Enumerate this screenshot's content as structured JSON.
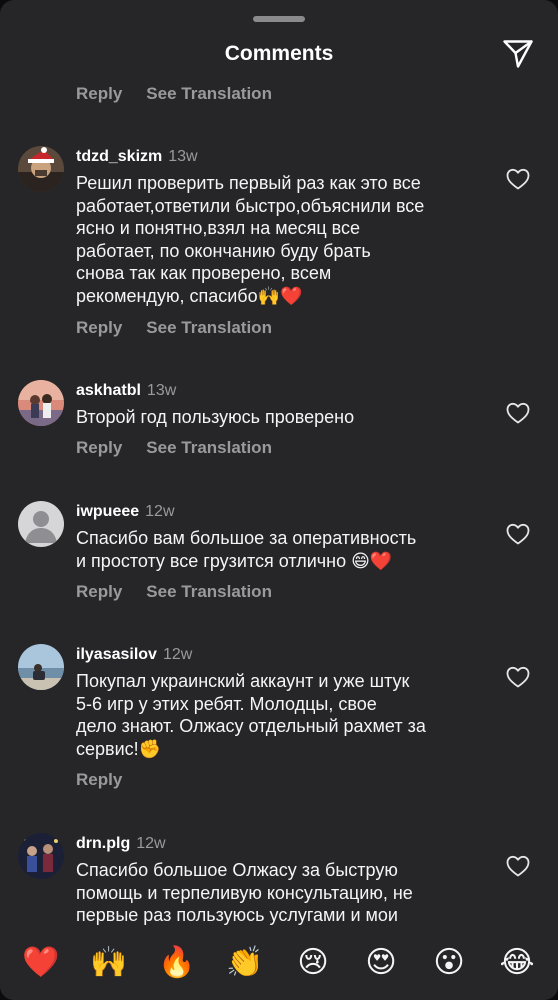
{
  "header": {
    "title": "Comments"
  },
  "actions": {
    "reply": "Reply",
    "see_translation": "See Translation"
  },
  "comments": [
    {
      "username": "tdzd_skizm",
      "time": "13w",
      "text_lines": [
        "Решил проверить первый раз как это все",
        "работает,ответили быстро,объяснили все",
        "ясно и понятно,взял на месяц все",
        "работает, по окончанию буду брать",
        "снова так как проверено, всем"
      ],
      "last_line": "рекомендую, спасибо",
      "emojis": "🙌❤️"
    },
    {
      "username": "askhatbl",
      "time": "13w",
      "text_lines": [
        "Второй год пользуюсь проверено"
      ]
    },
    {
      "username": "iwpueee",
      "time": "12w",
      "text_lines": [
        "Спасибо вам большое за оперативность"
      ],
      "last_line": "и простоту все грузится отлично ",
      "emojis": "😄❤️"
    },
    {
      "username": "ilyasasilov",
      "time": "12w",
      "text_lines": [
        "Покупал украинский аккаунт и уже штук",
        "5-6 игр у этих ребят. Молодцы, свое",
        "дело знают. Олжасу отдельный рахмет за"
      ],
      "last_line": "сервис!",
      "emojis": "✊"
    },
    {
      "username": "drn.plg",
      "time": "12w",
      "text_lines": [
        "Спасибо большое Олжасу за быструю",
        "помощь и терпеливую консультацию, не",
        "первые раз пользуюсь услугами и мои"
      ]
    }
  ],
  "reaction_bar": [
    "❤️",
    "🙌",
    "🔥",
    "👏",
    "😢",
    "😍",
    "😮",
    "😂"
  ]
}
